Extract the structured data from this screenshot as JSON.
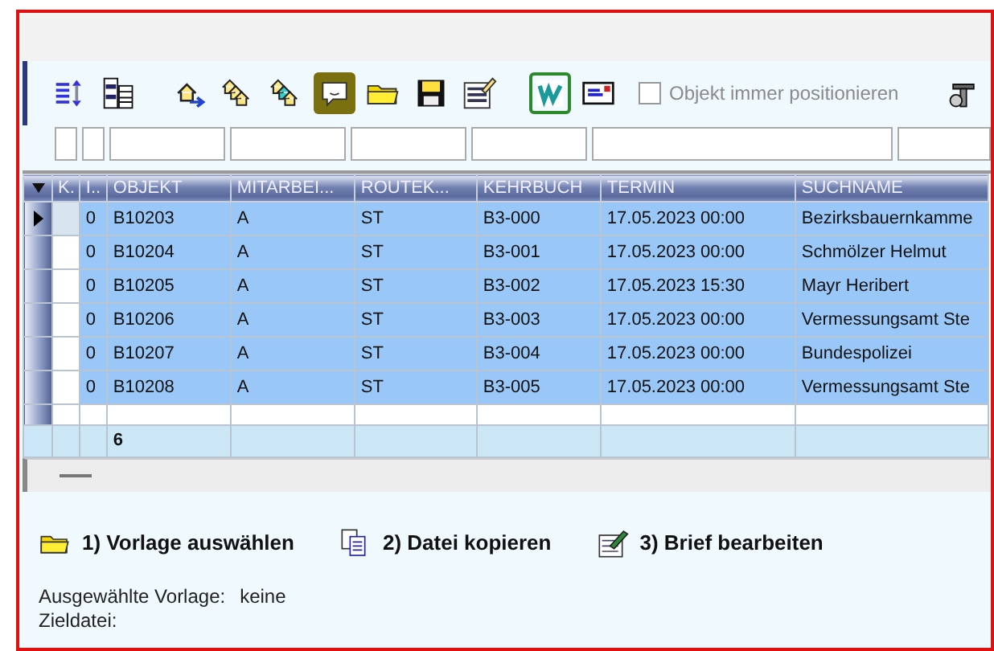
{
  "toolbar": {
    "tools": [
      {
        "kind": "sort",
        "pressed": false
      },
      {
        "kind": "columns",
        "pressed": false
      },
      {
        "kind": "house-arrow",
        "pressed": false
      },
      {
        "kind": "houses",
        "pressed": false
      },
      {
        "kind": "houses-color",
        "pressed": false
      },
      {
        "kind": "message",
        "pressed": true
      },
      {
        "kind": "folder",
        "pressed": false
      },
      {
        "kind": "save",
        "pressed": false
      },
      {
        "kind": "form-edit",
        "pressed": false
      },
      {
        "kind": "word",
        "pressed": true
      },
      {
        "kind": "letter",
        "pressed": false
      }
    ],
    "checkbox": {
      "label": "Objekt immer positionieren",
      "checked": false,
      "disabled": true
    },
    "end_tool": {
      "kind": "tools",
      "pressed": false
    }
  },
  "grid": {
    "columns": [
      {
        "label": "K.",
        "kind": "flag"
      },
      {
        "label": "I..",
        "kind": "text"
      },
      {
        "label": "OBJEKT",
        "kind": "id"
      },
      {
        "label": "MITARBEI...",
        "kind": "text"
      },
      {
        "label": "ROUTEK...",
        "kind": "text"
      },
      {
        "label": "KEHRBUCH",
        "kind": "text"
      },
      {
        "label": "TERMIN",
        "kind": "text"
      },
      {
        "label": "SUCHNAME",
        "kind": "text"
      }
    ],
    "rows": [
      {
        "cells": [
          "",
          "0",
          "B10203",
          "A",
          "ST",
          "B3-000",
          "17.05.2023 00:00",
          "Bezirksbauernkamme"
        ],
        "selected": true,
        "current": true
      },
      {
        "cells": [
          "",
          "0",
          "B10204",
          "A",
          "ST",
          "B3-001",
          "17.05.2023 00:00",
          "Schmölzer Helmut"
        ],
        "selected": true,
        "current": false
      },
      {
        "cells": [
          "",
          "0",
          "B10205",
          "A",
          "ST",
          "B3-002",
          "17.05.2023 15:30",
          "Mayr Heribert"
        ],
        "selected": true,
        "current": false
      },
      {
        "cells": [
          "",
          "0",
          "B10206",
          "A",
          "ST",
          "B3-003",
          "17.05.2023 00:00",
          "Vermessungsamt Ste"
        ],
        "selected": true,
        "current": false
      },
      {
        "cells": [
          "",
          "0",
          "B10207",
          "A",
          "ST",
          "B3-004",
          "17.05.2023 00:00",
          "Bundespolizei"
        ],
        "selected": true,
        "current": false
      },
      {
        "cells": [
          "",
          "0",
          "B10208",
          "A",
          "ST",
          "B3-005",
          "17.05.2023 00:00",
          "Vermessungsamt Ste"
        ],
        "selected": true,
        "current": false
      }
    ],
    "footer": {
      "count": "6"
    }
  },
  "actions": [
    {
      "kind": "folder",
      "label": "1) Vorlage auswählen"
    },
    {
      "kind": "copy",
      "label": "2) Datei kopieren"
    },
    {
      "kind": "edit",
      "label": "3) Brief bearbeiten"
    }
  ],
  "info": [
    {
      "label": "Ausgewählte Vorlage:",
      "value": "keine"
    },
    {
      "label": "Zieldatei:"
    }
  ]
}
